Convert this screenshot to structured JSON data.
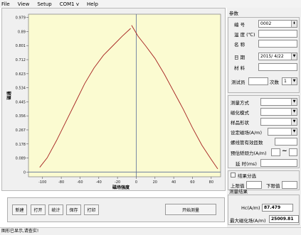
{
  "menu": [
    "File",
    "View",
    "Setup",
    "COM1 v",
    "Help"
  ],
  "chart_data": {
    "type": "line",
    "xlabel": "磁场强度",
    "ylabel": "磁通",
    "xticks": [
      -100,
      -80,
      -60,
      -40,
      -20,
      0,
      20,
      40,
      60,
      80
    ],
    "yticks": [
      0,
      0.089,
      0.178,
      0.267,
      0.356,
      0.445,
      0.534,
      0.623,
      0.712,
      0.801,
      0.89,
      0.979
    ],
    "xlim": [
      -115,
      90
    ],
    "ylim": [
      -0.03,
      1.0
    ],
    "grid": false,
    "colors": {
      "background": "#fbfbd1",
      "line": "#a52020",
      "axis": "#5a6d9a"
    },
    "series": [
      {
        "x": [
          -103,
          -95,
          -85,
          -75,
          -65,
          -55,
          -45,
          -35,
          -25,
          -15,
          -6
        ],
        "y": [
          0.03,
          0.09,
          0.2,
          0.32,
          0.44,
          0.56,
          0.66,
          0.74,
          0.8,
          0.86,
          0.91
        ]
      },
      {
        "x": [
          -5,
          2,
          10,
          20,
          30,
          40,
          50,
          60,
          70,
          80,
          87
        ],
        "y": [
          0.93,
          0.86,
          0.8,
          0.72,
          0.62,
          0.51,
          0.4,
          0.28,
          0.17,
          0.08,
          0.02
        ]
      }
    ]
  },
  "buttons": {
    "new": "新建",
    "open": "打开",
    "stats": "统计",
    "save": "保存",
    "print": "打印",
    "start": "开始测量"
  },
  "status": "图形已显示,请查实!",
  "params": {
    "title": "参数",
    "serial_label": "编 号",
    "serial_value": "0002",
    "temp_label": "温 度 (℃)",
    "temp_value": "",
    "name_label": "名 称",
    "name_value": "",
    "date_label": "日 期",
    "date_value": "2015/ 4/22",
    "material_label": "材 料",
    "material_value": "",
    "tester_label": "测试员",
    "tester_value": "",
    "count_label": "次数",
    "count_value": "1"
  },
  "measure": {
    "method_label": "测量方式",
    "method_value": "",
    "mag_mode_label": "磁化模式",
    "mag_mode_value": "",
    "shape_label": "样品形状",
    "shape_value": "",
    "field_label": "设定磁场(A/m)",
    "field_value": "",
    "coil_label": "螺线管有效匝数",
    "coil_value": "",
    "preset_label": "预估矫顽力(A/m)",
    "preset_value": "",
    "preset_sym": "~",
    "delay_label": "延  时(ms)",
    "delay_value": ""
  },
  "sorting": {
    "label": "结果分选",
    "lower_label": "上限值",
    "lower_value": "",
    "upper_label": "下限值",
    "upper_value": ""
  },
  "results": {
    "title": "测量结果",
    "hc_label": "Hc(A/m)",
    "hc_value": "87.479",
    "hmax_label": "最大磁化场(A/m)",
    "hmax_value": "25009.81"
  }
}
